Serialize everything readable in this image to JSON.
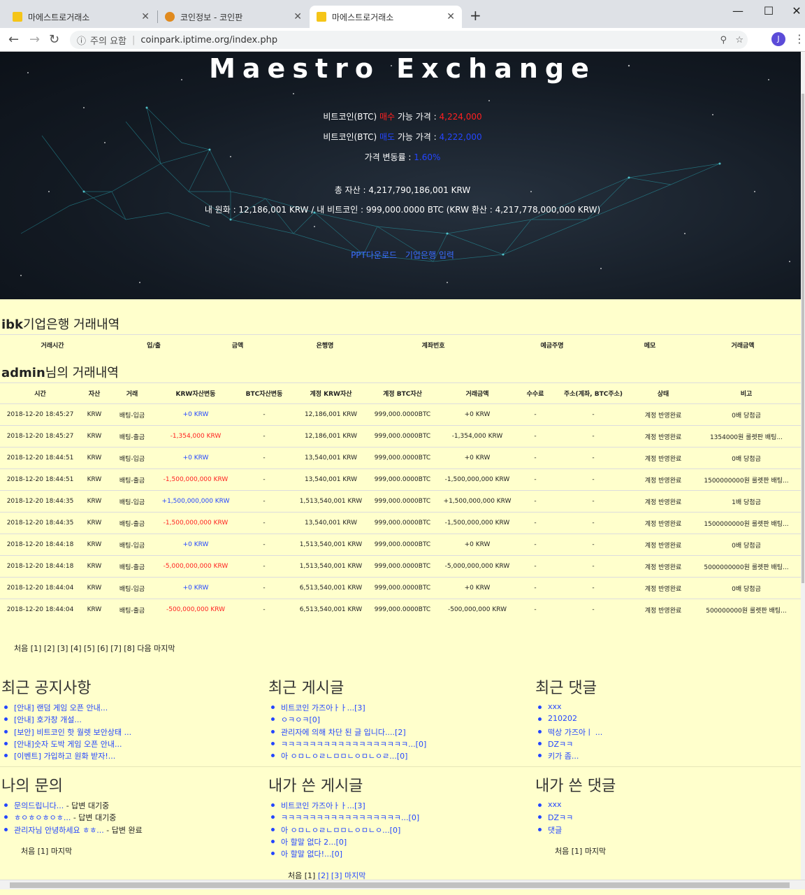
{
  "browser": {
    "tabs": [
      {
        "title": "마에스트로거래소",
        "active": false
      },
      {
        "title": "코인정보 - 코인판",
        "active": false
      },
      {
        "title": "마에스트로거래소",
        "active": true
      }
    ],
    "security_label": "주의 요함",
    "url": "coinpark.iptime.org/index.php",
    "avatar_letter": "J"
  },
  "hero": {
    "title": "Maestro Exchange",
    "buy_prefix": "비트코인(BTC) ",
    "buy_word": "매수",
    "buy_suffix": " 가능 가격 : ",
    "buy_price": "4,224,000",
    "sell_prefix": "비트코인(BTC) ",
    "sell_word": "매도",
    "sell_suffix": " 가능 가격 : ",
    "sell_price": "4,222,000",
    "change_label": "가격 변동률 : ",
    "change_value": "1.60%",
    "total_assets": "총 자산 : 4,217,790,186,001 KRW",
    "my_assets": "내 원화 : 12,186,001 KRW / 내 비트코인 : 999,000.0000 BTC (KRW 환산 : 4,217,778,000,000 KRW)",
    "link_ppt": "PPT다운로드",
    "link_bank": "기업은행 입력"
  },
  "ibk": {
    "title_bold": "ibk",
    "title_rest": "기업은행 거래내역",
    "columns": [
      "거래시간",
      "입/출",
      "금액",
      "은행명",
      "계좌번호",
      "예금주명",
      "메모",
      "거래금액"
    ]
  },
  "admin": {
    "title_bold": "admin",
    "title_rest": "님의 거래내역",
    "columns": [
      "시간",
      "자산",
      "거래",
      "KRW자산변동",
      "BTC자산변동",
      "계정 KRW자산",
      "계정 BTC자산",
      "거래금액",
      "수수료",
      "주소(계좌, BTC주소)",
      "상태",
      "비고"
    ],
    "rows": [
      [
        "2018-12-20 18:45:27",
        "KRW",
        "배팅-입금",
        "+0 KRW",
        "-",
        "12,186,001 KRW",
        "999,000.0000BTC",
        "+0 KRW",
        "-",
        "-",
        "계정 반영완료",
        "0배 당첨금"
      ],
      [
        "2018-12-20 18:45:27",
        "KRW",
        "배팅-출금",
        "-1,354,000 KRW",
        "-",
        "12,186,001 KRW",
        "999,000.0000BTC",
        "-1,354,000 KRW",
        "-",
        "-",
        "계정 반영완료",
        "1354000원 룰렛판 배팅..."
      ],
      [
        "2018-12-20 18:44:51",
        "KRW",
        "배팅-입금",
        "+0 KRW",
        "-",
        "13,540,001 KRW",
        "999,000.0000BTC",
        "+0 KRW",
        "-",
        "-",
        "계정 반영완료",
        "0배 당첨금"
      ],
      [
        "2018-12-20 18:44:51",
        "KRW",
        "배팅-출금",
        "-1,500,000,000 KRW",
        "-",
        "13,540,001 KRW",
        "999,000.0000BTC",
        "-1,500,000,000 KRW",
        "-",
        "-",
        "계정 반영완료",
        "1500000000원 룰렛판 배팅..."
      ],
      [
        "2018-12-20 18:44:35",
        "KRW",
        "배팅-입금",
        "+1,500,000,000 KRW",
        "-",
        "1,513,540,001 KRW",
        "999,000.0000BTC",
        "+1,500,000,000 KRW",
        "-",
        "-",
        "계정 반영완료",
        "1배 당첨금"
      ],
      [
        "2018-12-20 18:44:35",
        "KRW",
        "배팅-출금",
        "-1,500,000,000 KRW",
        "-",
        "13,540,001 KRW",
        "999,000.0000BTC",
        "-1,500,000,000 KRW",
        "-",
        "-",
        "계정 반영완료",
        "1500000000원 룰렛판 배팅..."
      ],
      [
        "2018-12-20 18:44:18",
        "KRW",
        "배팅-입금",
        "+0 KRW",
        "-",
        "1,513,540,001 KRW",
        "999,000.0000BTC",
        "+0 KRW",
        "-",
        "-",
        "계정 반영완료",
        "0배 당첨금"
      ],
      [
        "2018-12-20 18:44:18",
        "KRW",
        "배팅-출금",
        "-5,000,000,000 KRW",
        "-",
        "1,513,540,001 KRW",
        "999,000.0000BTC",
        "-5,000,000,000 KRW",
        "-",
        "-",
        "계정 반영완료",
        "5000000000원 룰렛판 배팅..."
      ],
      [
        "2018-12-20 18:44:04",
        "KRW",
        "배팅-입금",
        "+0 KRW",
        "-",
        "6,513,540,001 KRW",
        "999,000.0000BTC",
        "+0 KRW",
        "-",
        "-",
        "계정 반영완료",
        "0배 당첨금"
      ],
      [
        "2018-12-20 18:44:04",
        "KRW",
        "배팅-출금",
        "-500,000,000 KRW",
        "-",
        "6,513,540,001 KRW",
        "999,000.0000BTC",
        "-500,000,000 KRW",
        "-",
        "-",
        "계정 반영완료",
        "500000000원 룰렛판 배팅..."
      ]
    ],
    "pager": "처음 [1] [2] [3] [4] [5] [6] [7] [8] 다음 마지막"
  },
  "panels": {
    "notices": {
      "title": "최근 공지사항",
      "items": [
        "[안내] 랜덤 게임 오픈 안내...",
        "[안내] 호가창 개설...",
        "[보안] 비트코인 핫 월렛 보안상태 ...",
        "[안내]숫자 도박 게임 오픈 안내...",
        "[이벤트] 가입하고 원화 받자!..."
      ]
    },
    "posts": {
      "title": "최근 게시글",
      "items": [
        "비트코인 가즈아ㅏㅏ...[3]",
        "ㅇㅋㅇㅋ[0]",
        "관리자에 의해 차단 된 글 입니다....[2]",
        "ㅋㅋㅋㅋㅋㅋㅋㅋㅋㅋㅋㅋㅋㅋㅋㅋㅋㅋ...[0]",
        "아 ㅇㅁㄴㅇㄹㄴㅁㅁㄴㅇㅁㄴㅇㄹ...[0]"
      ]
    },
    "comments": {
      "title": "최근 댓글",
      "items": [
        "xxx",
        "210202",
        "떡상 가즈아ㅣ ...",
        "DZㅋㅋ",
        "키가 좀..."
      ]
    },
    "my_inquiries": {
      "title": "나의 문의",
      "items": [
        {
          "text": "문의드립니다...",
          "status": " - 답변 대기중"
        },
        {
          "text": "ㅎㅇㅎㅇㅎㅇㅎ...",
          "status": " - 답변 대기중"
        },
        {
          "text": "관리자님 안녕하세요 ㅎㅎ...",
          "status": " - 답변 완료"
        }
      ],
      "pager": "처음 [1] 마지막"
    },
    "my_posts": {
      "title": "내가 쓴 게시글",
      "items": [
        "비트코인 가즈아ㅏㅏ...[3]",
        "ㅋㅋㅋㅋㅋㅋㅋㅋㅋㅋㅋㅋㅋㅋㅋㅋㅋ...[0]",
        "아 ㅇㅁㄴㅇㄹㄴㅁㅁㄴㅇㅁㄴㅇ...[0]",
        "아 할말 없다 2...[0]",
        "아 할말 없다!...[0]"
      ],
      "pager_first": "처음 [1]",
      "pager_links": "[2] [3] 마지막"
    },
    "my_comments": {
      "title": "내가 쓴 댓글",
      "items": [
        "xxx",
        "DZㅋㅋ",
        "댓글"
      ],
      "pager": "처음 [1] 마지막"
    }
  },
  "colors": {
    "page_bg": "#ffffcc",
    "buy": "#ff2020",
    "sell": "#2446ff",
    "link": "#2446ff"
  }
}
